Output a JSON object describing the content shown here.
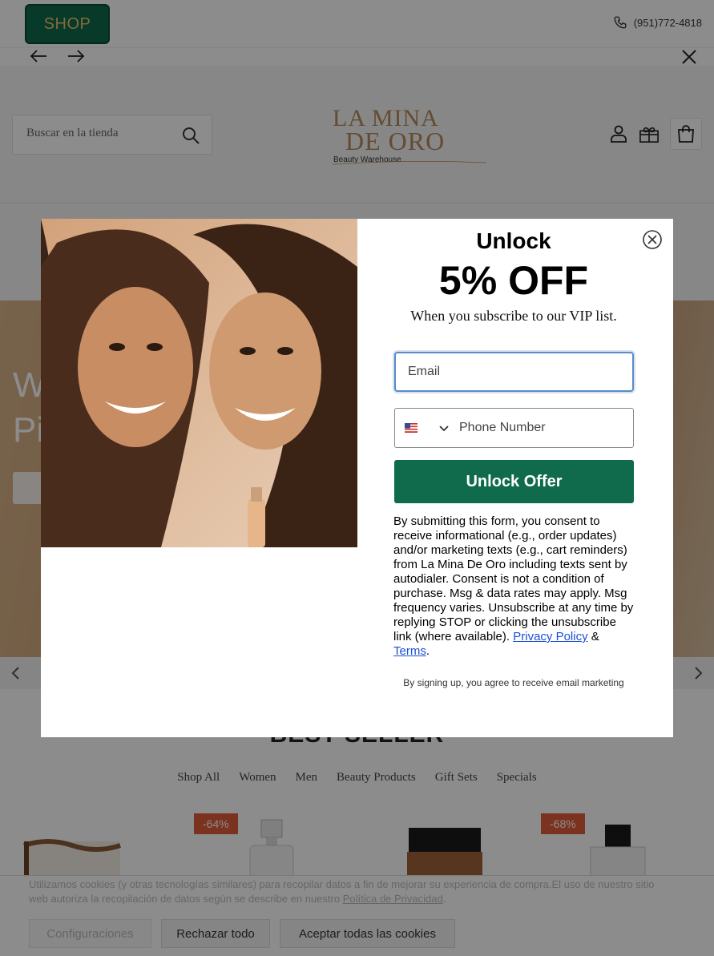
{
  "topbar": {
    "shop_label": "SHOP",
    "phone": "(951)772-4818"
  },
  "header": {
    "search_placeholder": "Buscar en la tienda",
    "logo_line1": "LA MINA",
    "logo_line2": "DE ORO",
    "logo_tagline": "Beauty Warehouse"
  },
  "hero": {
    "title_line1": "W",
    "title_line2": "Pi"
  },
  "modal": {
    "headline": "Unlock",
    "offer": "5% OFF",
    "subhead": "When you subscribe to our VIP list.",
    "email_placeholder": "Email",
    "phone_placeholder": "Phone Number",
    "submit_label": "Unlock Offer",
    "legal_text": "By submitting this form, you consent to receive informational (e.g., order updates) and/or marketing texts (e.g., cart reminders) from La Mina De Oro including texts sent by autodialer. Consent is not a condition of purchase. Msg & data rates may apply. Msg frequency varies. Unsubscribe at any time by replying STOP or clicking the unsubscribe link (where available). ",
    "privacy_link": "Privacy Policy",
    "amp": " & ",
    "terms_link": "Terms",
    "period": ".",
    "footer_note": "By signing up, you agree to receive email marketing"
  },
  "bestseller": {
    "title": "BEST SELLER",
    "tabs": [
      "Shop All",
      "Women",
      "Men",
      "Beauty Products",
      "Gift Sets",
      "Specials"
    ],
    "badges": [
      "-64%",
      "-68%"
    ]
  },
  "cookie": {
    "text": "Utilizamos cookies (y otras tecnologías similares) para recopilar datos a fin de mejorar su experiencia de compra.El uso de nuestro sitio web autoriza la recopilación de datos según se describe en nuestro ",
    "policy_link": "Política de Privacidad",
    "policy_end": ".",
    "config_label": "Configuraciones",
    "reject_label": "Rechazar todo",
    "accept_label": "Aceptar todas las cookies"
  },
  "colors": {
    "brand_green": "#0f6b4b",
    "sale_badge": "#e05b3a",
    "link_blue": "#1a4fd6"
  },
  "icons": [
    "phone-icon",
    "arrow-left-icon",
    "arrow-right-icon",
    "close-icon",
    "search-icon",
    "account-icon",
    "gift-card-icon",
    "cart-icon",
    "us-flag-icon",
    "chevron-down-icon"
  ]
}
